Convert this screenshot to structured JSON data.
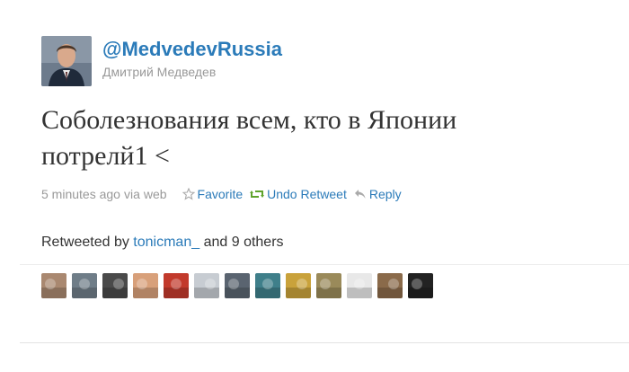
{
  "tweet": {
    "screen_name": "@MedvedevRussia",
    "full_name": "Дмитрий Медведев",
    "text_line1": "Соболезнования всем, кто в Японии",
    "text_line2": "потрелй1 <",
    "timestamp": "5 minutes ago",
    "via": "via",
    "source": "web"
  },
  "actions": {
    "favorite_label": "Favorite",
    "undo_retweet_label": "Undo Retweet",
    "reply_label": "Reply"
  },
  "retweeted_by": {
    "prefix": "Retweeted by",
    "user": "tonicman_",
    "suffix": "and 9 others"
  },
  "retweeter_avatars": [
    {
      "icon": "user-avatar",
      "color": "#a98870"
    },
    {
      "icon": "user-avatar",
      "color": "#6f7d88"
    },
    {
      "icon": "user-avatar",
      "color": "#4a4a4a"
    },
    {
      "icon": "user-avatar",
      "color": "#d8a07a"
    },
    {
      "icon": "user-avatar",
      "color": "#c23a2c"
    },
    {
      "icon": "user-avatar",
      "color": "#c7ccd2"
    },
    {
      "icon": "user-avatar",
      "color": "#5a6470"
    },
    {
      "icon": "user-avatar",
      "color": "#3f7f8a"
    },
    {
      "icon": "user-avatar",
      "color": "#c9a23b"
    },
    {
      "icon": "user-avatar",
      "color": "#9a8a5a"
    },
    {
      "icon": "user-avatar",
      "color": "#e8e8e8"
    },
    {
      "icon": "user-avatar",
      "color": "#8a6a4a"
    },
    {
      "icon": "user-avatar",
      "color": "#222222"
    }
  ],
  "colors": {
    "link": "#2b7bb9",
    "muted": "#999999",
    "text": "#333333",
    "retweet_green": "#5ea32b"
  }
}
